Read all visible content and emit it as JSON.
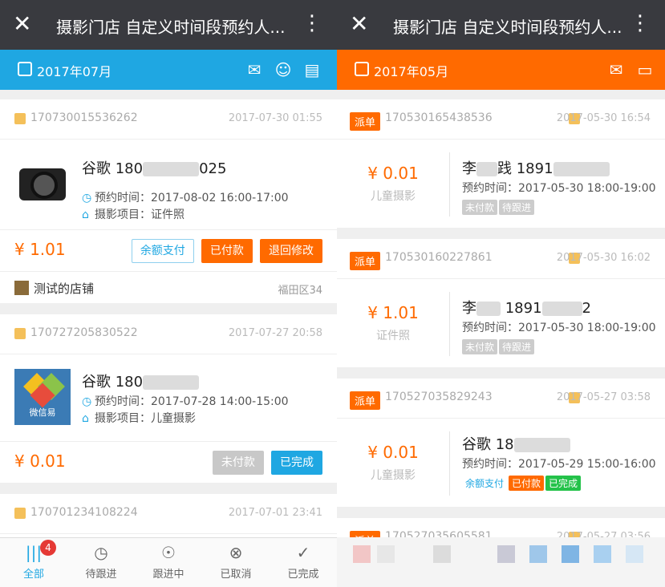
{
  "left": {
    "title": "摄影门店 自定义时间段预约人...",
    "close_icon": "close-icon",
    "month": "2017年07月",
    "orders": [
      {
        "order_no": "170730015536262",
        "date": "2017-07-30 01:55",
        "name": "谷歌 180",
        "name_tail": "025",
        "time_label": "预约时间：",
        "time": "2017-08-02 16:00-17:00",
        "project_label": "摄影项目：",
        "project": "证件照",
        "price": "¥ 1.01",
        "buttons": [
          "余额支付",
          "已付款",
          "退回修改"
        ],
        "shop_name": "测试的店铺",
        "shop_area": "福田区34"
      },
      {
        "order_no": "170727205830522",
        "date": "2017-07-27 20:58",
        "name": "谷歌 180",
        "time_label": "预约时间：",
        "time": "2017-07-28 14:00-15:00",
        "project_label": "摄影项目：",
        "project": "儿童摄影",
        "price": "¥ 0.01",
        "buttons": [
          "未付款",
          "已完成"
        ],
        "thumb_text": "微信易"
      },
      {
        "order_no": "170701234108224",
        "date": "2017-07-01 23:41"
      }
    ],
    "tabs": [
      {
        "label": "全部",
        "badge": "4"
      },
      {
        "label": "待跟进"
      },
      {
        "label": "跟进中"
      },
      {
        "label": "已取消"
      },
      {
        "label": "已完成"
      }
    ]
  },
  "right": {
    "title": "摄影门店 自定义时间段预约人...",
    "month": "2017年05月",
    "dispatch_label": "派单",
    "orders": [
      {
        "order_no": "170530165438536",
        "date": "2017-05-30 16:54",
        "price": "¥ 0.01",
        "project": "儿童摄影",
        "name": "李",
        "name_mid": "践",
        "name_num": "1891",
        "time_label": "预约时间：",
        "time": "2017-05-30 18:00-19:00",
        "tags": [
          "未付款",
          "待跟进"
        ]
      },
      {
        "order_no": "170530160227861",
        "date": "2017-05-30 16:02",
        "price": "¥ 1.01",
        "project": "证件照",
        "name": "李",
        "name_num": "1891",
        "name_tail": "2",
        "time_label": "预约时间：",
        "time": "2017-05-30 18:00-19:00",
        "tags": [
          "未付款",
          "待跟进"
        ]
      },
      {
        "order_no": "170527035829243",
        "date": "2017-05-27 03:58",
        "price": "¥ 0.01",
        "project": "儿童摄影",
        "name": "谷歌 18",
        "time_label": "预约时间：",
        "time": "2017-05-29 15:00-16:00",
        "tags": [
          "余额支付",
          "已付款",
          "已完成"
        ]
      },
      {
        "order_no": "170527035605581",
        "date": "2017-05-27 03:56"
      }
    ]
  },
  "colors": {
    "accent_blue": "#1fa7e2",
    "accent_orange": "#ff6a00",
    "top_bar": "#393a3f",
    "done_green": "#24c24a"
  }
}
